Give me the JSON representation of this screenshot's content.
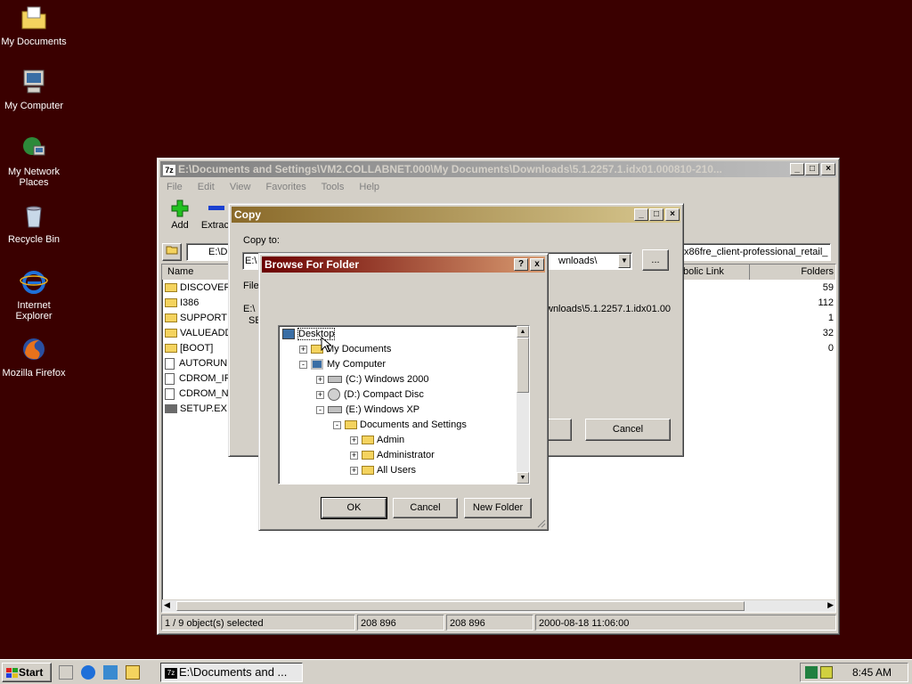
{
  "desktop": {
    "icons": [
      {
        "label": "My Documents",
        "icon": "folder-documents-icon"
      },
      {
        "label": "My Computer",
        "icon": "computer-icon"
      },
      {
        "label": "My Network Places",
        "icon": "network-icon"
      },
      {
        "label": "Recycle Bin",
        "icon": "recycle-bin-icon"
      },
      {
        "label": "Internet Explorer",
        "icon": "internet-explorer-icon"
      },
      {
        "label": "Mozilla Firefox",
        "icon": "firefox-icon"
      }
    ]
  },
  "main_window": {
    "title": "E:\\Documents and Settings\\VM2.COLLABNET.000\\My Documents\\Downloads\\5.1.2257.1.idx01.000810-210...",
    "menu": [
      "File",
      "Edit",
      "View",
      "Favorites",
      "Tools",
      "Help"
    ],
    "toolbar": {
      "add": "Add",
      "extract": "Extract"
    },
    "address_fragment": "E:\\D",
    "address_right": "x86fre_client-professional_retail_",
    "columns": {
      "name": "Name",
      "symbolic": "bolic Link",
      "folders": "Folders"
    },
    "files": [
      {
        "name": "DISCOVER",
        "folders": "59",
        "type": "folder"
      },
      {
        "name": "I386",
        "folders": "112",
        "type": "folder"
      },
      {
        "name": "SUPPORT",
        "folders": "1",
        "type": "folder"
      },
      {
        "name": "VALUEADD",
        "folders": "32",
        "type": "folder"
      },
      {
        "name": "[BOOT]",
        "folders": "0",
        "type": "folder"
      },
      {
        "name": "AUTORUN",
        "folders": "",
        "type": "file"
      },
      {
        "name": "CDROM_IF",
        "folders": "",
        "type": "file"
      },
      {
        "name": "CDROM_N",
        "folders": "",
        "type": "file"
      },
      {
        "name": "SETUP.EX",
        "folders": "",
        "type": "exe"
      }
    ],
    "status": {
      "selected": "1 / 9 object(s) selected",
      "size1": "208 896",
      "size2": "208 896",
      "date": "2000-08-18 11:06:00"
    }
  },
  "copy_dialog": {
    "title": "Copy",
    "copy_to_label": "Copy to:",
    "copy_to_value_left": "E:\\",
    "copy_to_value_right": "wnloads\\",
    "browse_button": "...",
    "files_label": "Files",
    "files_line1_left": "E:\\",
    "files_line1_right": "wnloads\\5.1.2257.1.idx01.00",
    "files_line2_left": "SE",
    "cancel": "Cancel"
  },
  "browse_dialog": {
    "title": "Browse For Folder",
    "help": "?",
    "close": "x",
    "tree": [
      {
        "label": "Desktop",
        "depth": 0,
        "exp": "",
        "icon": "desktop-icon"
      },
      {
        "label": "My Documents",
        "depth": 1,
        "exp": "+",
        "icon": "folder-icon"
      },
      {
        "label": "My Computer",
        "depth": 1,
        "exp": "-",
        "icon": "computer-icon"
      },
      {
        "label": "(C:) Windows 2000",
        "depth": 2,
        "exp": "+",
        "icon": "drive-icon"
      },
      {
        "label": "(D:) Compact Disc",
        "depth": 2,
        "exp": "+",
        "icon": "cd-drive-icon"
      },
      {
        "label": "(E:) Windows XP",
        "depth": 2,
        "exp": "-",
        "icon": "drive-icon"
      },
      {
        "label": "Documents and Settings",
        "depth": 3,
        "exp": "-",
        "icon": "folder-icon"
      },
      {
        "label": "Admin",
        "depth": 4,
        "exp": "+",
        "icon": "folder-icon"
      },
      {
        "label": "Administrator",
        "depth": 4,
        "exp": "+",
        "icon": "folder-icon"
      },
      {
        "label": "All Users",
        "depth": 4,
        "exp": "+",
        "icon": "folder-icon"
      }
    ],
    "ok": "OK",
    "cancel": "Cancel",
    "new_folder": "New Folder"
  },
  "taskbar": {
    "start": "Start",
    "task": "E:\\Documents and ...",
    "clock": "8:45 AM"
  }
}
